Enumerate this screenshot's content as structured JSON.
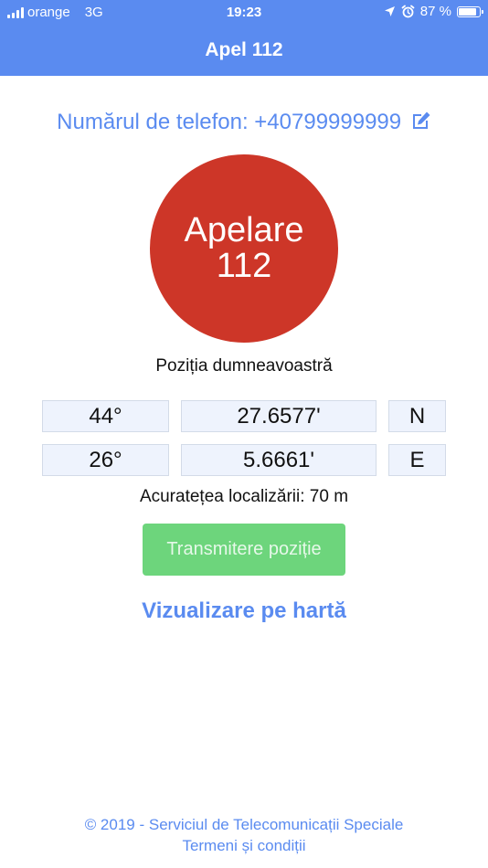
{
  "status_bar": {
    "carrier": "orange",
    "network": "3G",
    "time": "19:23",
    "battery": "87 %",
    "battery_level": 0.87,
    "icons": [
      "signal-icon",
      "location-arrow-icon",
      "alarm-icon",
      "battery-icon"
    ]
  },
  "header": {
    "title": "Apel 112"
  },
  "phone": {
    "label": "Numărul de telefon: +40799999999",
    "icon": "edit-icon"
  },
  "call_button": {
    "line1": "Apelare",
    "line2": "112"
  },
  "position": {
    "title": "Poziția dumneavoastră",
    "latitude": {
      "degrees": "44°",
      "minutes": "27.6577'",
      "hemisphere": "N"
    },
    "longitude": {
      "degrees": "26°",
      "minutes": "5.6661'",
      "hemisphere": "E"
    },
    "accuracy": "Acuratețea localizării: 70 m"
  },
  "transmit_button": {
    "label": "Transmitere poziție"
  },
  "map_link": {
    "label": "Vizualizare pe hartă"
  },
  "footer": {
    "copyright": "© 2019 - Serviciul de Telecomunicații Speciale",
    "terms": "Termeni și condiții"
  },
  "colors": {
    "primary": "#5a8bf0",
    "call": "#cd3628",
    "transmit": "#6dd57c",
    "field_background": "#eef3fd"
  }
}
